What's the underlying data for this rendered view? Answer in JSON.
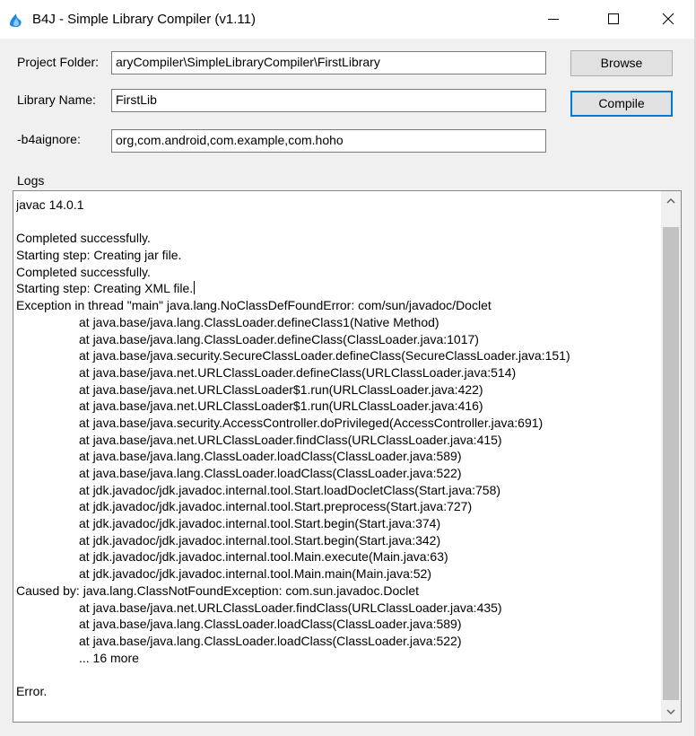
{
  "window": {
    "title": "B4J - Simple Library Compiler (v1.11)"
  },
  "form": {
    "project_folder_label": "Project Folder:",
    "project_folder_value": "aryCompiler\\SimpleLibraryCompiler\\FirstLibrary",
    "library_name_label": "Library Name:",
    "library_name_value": "FirstLib",
    "b4aignore_label": "-b4aignore:",
    "b4aignore_value": "org,com.android,com.example,com.hoho",
    "browse_label": "Browse",
    "compile_label": "Compile"
  },
  "logs": {
    "label": "Logs",
    "lines": [
      {
        "text": "javac 14.0.1",
        "indent": false
      },
      {
        "text": "",
        "indent": false
      },
      {
        "text": "Completed successfully.",
        "indent": false
      },
      {
        "text": "Starting step: Creating jar file.",
        "indent": false
      },
      {
        "text": "Completed successfully.",
        "indent": false
      },
      {
        "text": "Starting step: Creating XML file.",
        "indent": false,
        "caret": true
      },
      {
        "text": "Exception in thread \"main\" java.lang.NoClassDefFoundError: com/sun/javadoc/Doclet",
        "indent": false
      },
      {
        "text": "at java.base/java.lang.ClassLoader.defineClass1(Native Method)",
        "indent": true
      },
      {
        "text": "at java.base/java.lang.ClassLoader.defineClass(ClassLoader.java:1017)",
        "indent": true
      },
      {
        "text": "at java.base/java.security.SecureClassLoader.defineClass(SecureClassLoader.java:151)",
        "indent": true
      },
      {
        "text": "at java.base/java.net.URLClassLoader.defineClass(URLClassLoader.java:514)",
        "indent": true
      },
      {
        "text": "at java.base/java.net.URLClassLoader$1.run(URLClassLoader.java:422)",
        "indent": true
      },
      {
        "text": "at java.base/java.net.URLClassLoader$1.run(URLClassLoader.java:416)",
        "indent": true
      },
      {
        "text": "at java.base/java.security.AccessController.doPrivileged(AccessController.java:691)",
        "indent": true
      },
      {
        "text": "at java.base/java.net.URLClassLoader.findClass(URLClassLoader.java:415)",
        "indent": true
      },
      {
        "text": "at java.base/java.lang.ClassLoader.loadClass(ClassLoader.java:589)",
        "indent": true
      },
      {
        "text": "at java.base/java.lang.ClassLoader.loadClass(ClassLoader.java:522)",
        "indent": true
      },
      {
        "text": "at jdk.javadoc/jdk.javadoc.internal.tool.Start.loadDocletClass(Start.java:758)",
        "indent": true
      },
      {
        "text": "at jdk.javadoc/jdk.javadoc.internal.tool.Start.preprocess(Start.java:727)",
        "indent": true
      },
      {
        "text": "at jdk.javadoc/jdk.javadoc.internal.tool.Start.begin(Start.java:374)",
        "indent": true
      },
      {
        "text": "at jdk.javadoc/jdk.javadoc.internal.tool.Start.begin(Start.java:342)",
        "indent": true
      },
      {
        "text": "at jdk.javadoc/jdk.javadoc.internal.tool.Main.execute(Main.java:63)",
        "indent": true
      },
      {
        "text": "at jdk.javadoc/jdk.javadoc.internal.tool.Main.main(Main.java:52)",
        "indent": true
      },
      {
        "text": "Caused by: java.lang.ClassNotFoundException: com.sun.javadoc.Doclet",
        "indent": false
      },
      {
        "text": "at java.base/java.net.URLClassLoader.findClass(URLClassLoader.java:435)",
        "indent": true
      },
      {
        "text": "at java.base/java.lang.ClassLoader.loadClass(ClassLoader.java:589)",
        "indent": true
      },
      {
        "text": "at java.base/java.lang.ClassLoader.loadClass(ClassLoader.java:522)",
        "indent": true
      },
      {
        "text": "... 16 more",
        "indent": true
      },
      {
        "text": "",
        "indent": false
      },
      {
        "text": "Error.",
        "indent": false
      }
    ]
  },
  "icons": {
    "app": "b4j-logo-icon",
    "minimize": "minimize-icon",
    "maximize": "maximize-icon",
    "close": "close-icon",
    "scroll_up": "chevron-up-icon",
    "scroll_down": "chevron-down-icon"
  },
  "colors": {
    "window_bg": "#f0f0f0",
    "default_button_border": "#0078d7",
    "button_bg": "#e1e1e1",
    "logo_blue": "#1e88e5"
  }
}
